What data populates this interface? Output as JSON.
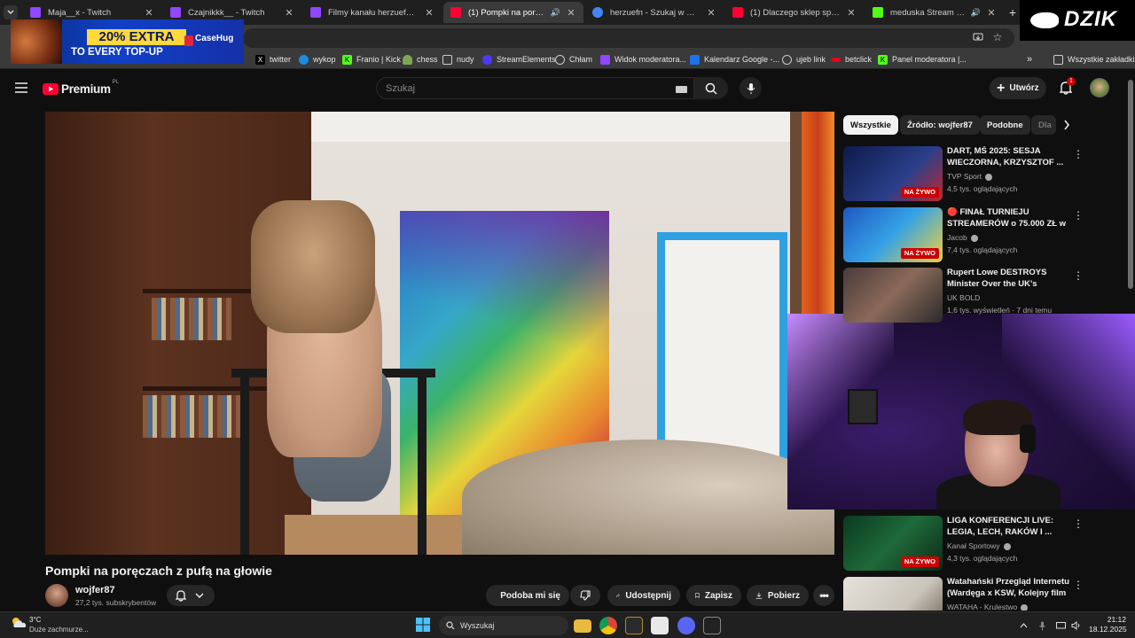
{
  "browser": {
    "tabs": [
      {
        "title": "Maja__x - Twitch",
        "fav_color": "#9146ff",
        "active": false
      },
      {
        "title": "Czajnikkk__ - Twitch",
        "fav_color": "#9146ff",
        "active": false
      },
      {
        "title": "Filmy kanału herzuefn - Twitch",
        "fav_color": "#9146ff",
        "active": false
      },
      {
        "title": "(1) Pompki na poręczach z ...",
        "fav_color": "#ff0033",
        "active": true
      },
      {
        "title": "herzuefn - Szukaj w Google",
        "fav_color": "#4285f4",
        "active": false
      },
      {
        "title": "(1) Dlaczego sklep spożywczy ...",
        "fav_color": "#ff0033",
        "active": false
      },
      {
        "title": "meduska Stream - Watch L...",
        "fav_color": "#53fc18",
        "active": false
      }
    ],
    "bookmarks": [
      {
        "label": "twitter",
        "icon": "x-icon"
      },
      {
        "label": "wykop",
        "icon": "wykop-icon"
      },
      {
        "label": "Franio | Kick",
        "icon": "kick-icon"
      },
      {
        "label": "chess",
        "icon": "pawn-icon"
      },
      {
        "label": "nudy",
        "icon": "folder-icon"
      },
      {
        "label": "StreamElements",
        "icon": "streamelements-icon"
      },
      {
        "label": "Chłam",
        "icon": "globe-icon"
      },
      {
        "label": "Widok moderatora...",
        "icon": "twitch-icon"
      },
      {
        "label": "Kalendarz Google -...",
        "icon": "calendar-icon"
      },
      {
        "label": "ujeb link",
        "icon": "globe-icon"
      },
      {
        "label": "betclick",
        "icon": "betclick-icon"
      },
      {
        "label": "Panel moderatora |...",
        "icon": "kick-icon"
      }
    ],
    "all_bookmarks_label": "Wszystkie zakładki"
  },
  "ad": {
    "line1": "20% EXTRA",
    "line2": "TO EVERY TOP-UP",
    "brand": "CaseHug"
  },
  "overlay_logo": "DZIK",
  "youtube": {
    "logo_text": "Premium",
    "logo_region": "PL",
    "search_placeholder": "Szukaj",
    "create_label": "Utwórz",
    "notification_count": "1",
    "video": {
      "title": "Pompki na poręczach z pufą na głowie",
      "channel": "wojfer87",
      "subscribers": "27,2 tys. subskrybentów",
      "like_label": "Podoba mi się",
      "share_label": "Udostępnij",
      "save_label": "Zapisz",
      "download_label": "Pobierz"
    },
    "chips": [
      "Wszystkie",
      "Źródło: wojfer87",
      "Podobne",
      "Dla"
    ],
    "recommendations": [
      {
        "title": "DART, MŚ 2025: SESJA WIECZORNA, KRZYSZTOF ...",
        "channel": "TVP Sport",
        "meta": "4,5 tys. oglądających",
        "badge": "NA ŻYWO",
        "thumb": "#1a2a6a"
      },
      {
        "title": "🔴 FINAŁ TURNIEJU STREAMERÓW o 75.000 ZŁ w ...",
        "channel": "Jacob",
        "meta": "7,4 tys. oglądających",
        "badge": "NA ŻYWO",
        "thumb": "#2b5fb8"
      },
      {
        "title": "Rupert Lowe DESTROYS Minister Over the UK's Missing...",
        "channel": "UK BOLD",
        "meta": "1,6 tys. wyświetleń · 7 dni temu",
        "badge": "",
        "thumb": "#3a3232"
      },
      {
        "title": "LIGA KONFERENCJI LIVE: LEGIA, LECH, RAKÓW I ...",
        "channel": "Kanał Sportowy",
        "meta": "4,3 tys. oglądających",
        "badge": "NA ŻYWO",
        "thumb": "#0f4a2a"
      },
      {
        "title": "Watahański Przegląd Internetu (Wardęga x KSW, Kolejny film ...",
        "channel": "WATAHA - Krulestwo",
        "meta": "",
        "badge": "",
        "thumb": "#d8d4cc"
      }
    ]
  },
  "taskbar": {
    "temperature": "3°C",
    "weather_desc": "Duże zachmurze...",
    "search_label": "Wyszukaj",
    "time": "21:12",
    "date": "18.12.2025"
  }
}
